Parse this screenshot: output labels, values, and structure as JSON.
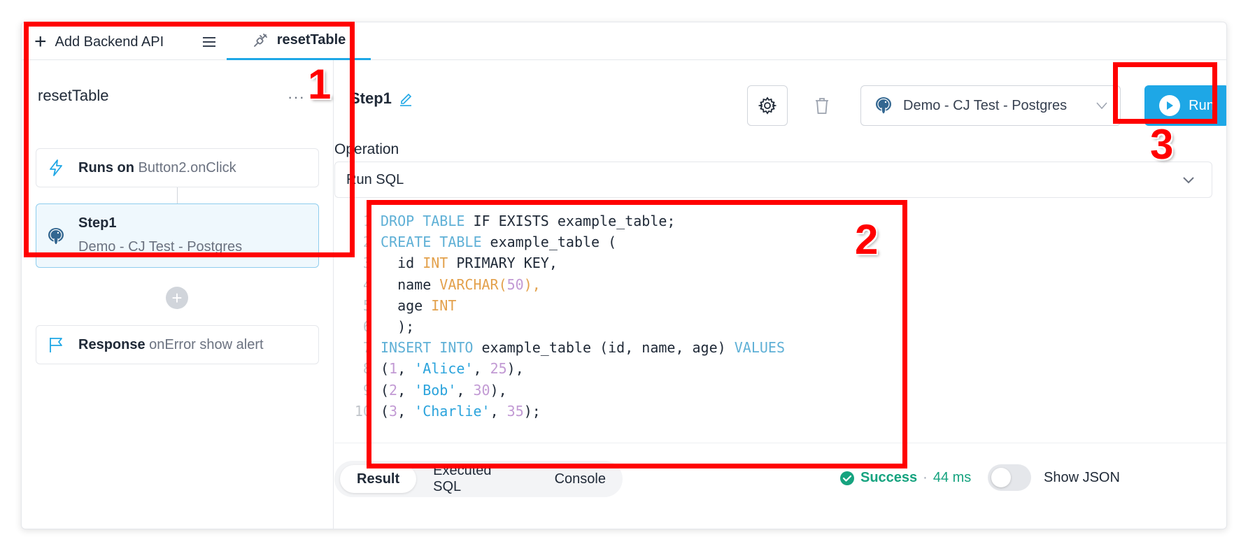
{
  "tabbar": {
    "add_label": "Add Backend API",
    "active_tab_label": "resetTable"
  },
  "left": {
    "api_title": "resetTable",
    "more_label": "···",
    "trigger": {
      "bold": "Runs on",
      "value": "Button2.onClick"
    },
    "step": {
      "name": "Step1",
      "datasource": "Demo - CJ Test - Postgres"
    },
    "add_symbol": "+",
    "response": {
      "bold": "Response",
      "value": "onError show alert"
    }
  },
  "right": {
    "step_title": "Step1",
    "datasource_select": "Demo - CJ Test - Postgres",
    "run_label": "Run",
    "operation_label": "Operation",
    "operation_value": "Run SQL"
  },
  "code_lines": [
    {
      "n": "1"
    },
    {
      "n": "2"
    },
    {
      "n": "3"
    },
    {
      "n": "4"
    },
    {
      "n": "5"
    },
    {
      "n": "6"
    },
    {
      "n": "7"
    },
    {
      "n": "8"
    },
    {
      "n": "9"
    },
    {
      "n": "10"
    }
  ],
  "code": {
    "l1": {
      "a": "DROP TABLE",
      "b": " IF EXISTS example_table;"
    },
    "l2": {
      "a": "CREATE TABLE",
      "b": " example_table ("
    },
    "l3": {
      "a": "  id ",
      "b": "INT",
      "c": " PRIMARY KEY,"
    },
    "l4": {
      "a": "  name ",
      "b": "VARCHAR",
      "c": "(",
      "d": "50",
      "e": "),"
    },
    "l5": {
      "a": "  age ",
      "b": "INT"
    },
    "l6": {
      "a": "  );"
    },
    "l7": {
      "a": "INSERT INTO",
      "b": " example_table (id, name, age) ",
      "c": "VALUES"
    },
    "l8": {
      "a": "(",
      "b": "1",
      "c": ", ",
      "d": "'Alice'",
      "e": ", ",
      "f": "25",
      "g": "),"
    },
    "l9": {
      "a": "(",
      "b": "2",
      "c": ", ",
      "d": "'Bob'",
      "e": ", ",
      "f": "30",
      "g": "),"
    },
    "l10": {
      "a": "(",
      "b": "3",
      "c": ", ",
      "d": "'Charlie'",
      "e": ", ",
      "f": "35",
      "g": ");"
    }
  },
  "result_tabs": [
    "Result",
    "Executed SQL",
    "Console"
  ],
  "status": {
    "label": "Success",
    "separator": "·",
    "duration": "44 ms"
  },
  "toggle_label": "Show JSON",
  "annotations": [
    "1",
    "2",
    "3"
  ],
  "colors": {
    "accent": "#1ea7e6",
    "success": "#16a37f",
    "annotation": "#ff0000",
    "keyword": "#5fb0d6",
    "type": "#e3a14c",
    "number": "#c29ad4",
    "string": "#2aa3dc"
  },
  "icons": {
    "add": "plus-icon",
    "menu": "hamburger-menu-icon",
    "api": "plug-link-icon",
    "trigger": "lightning-icon",
    "postgres": "postgres-elephant-icon",
    "response": "flag-icon",
    "edit": "pencil-icon",
    "settings": "gear-icon",
    "delete": "trash-icon",
    "run": "play-icon",
    "dropdown": "chevron-down-icon",
    "success": "check-circle-icon"
  }
}
